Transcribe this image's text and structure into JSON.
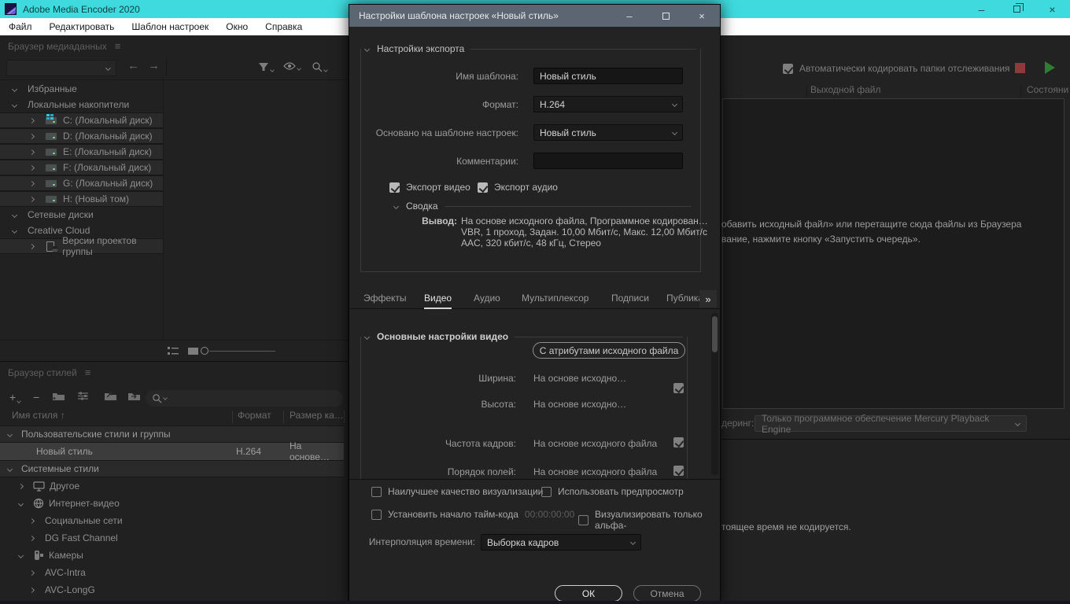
{
  "window": {
    "title": "Adobe Media Encoder 2020"
  },
  "glyphs": {
    "hamburger": "≡",
    "back": "←",
    "forward": "→",
    "sort_asc": "↑",
    "tab_overflow": "»",
    "minimize": "–",
    "close": "×",
    "plus": "+",
    "minus": "−"
  },
  "menu": {
    "items": [
      "Файл",
      "Редактировать",
      "Шаблон настроек",
      "Окно",
      "Справка"
    ]
  },
  "media_browser": {
    "title": "Браузер медиаданных",
    "tree": [
      {
        "label": "Избранные"
      },
      {
        "label": "Локальные накопители"
      },
      {
        "label": "C: (Локальный диск)"
      },
      {
        "label": "D: (Локальный диск)"
      },
      {
        "label": "E: (Локальный диск)"
      },
      {
        "label": "F: (Локальный диск)"
      },
      {
        "label": "G: (Локальный диск)"
      },
      {
        "label": "H: (Новый том)"
      },
      {
        "label": "Сетевые диски"
      },
      {
        "label": "Creative Cloud"
      },
      {
        "label": "Версии проектов группы"
      }
    ]
  },
  "preset_browser": {
    "title": "Браузер стилей",
    "columns": {
      "name": "Имя стиля",
      "format": "Формат",
      "size": "Размер ка…"
    },
    "rows": [
      {
        "label": "Пользовательские стили и группы"
      },
      {
        "label": "Новый стиль",
        "format": "H.264",
        "size": "На основе…"
      },
      {
        "label": "Системные стили"
      },
      {
        "label": "Другое"
      },
      {
        "label": "Интернет-видео"
      },
      {
        "label": "Социальные сети"
      },
      {
        "label": "DG Fast Channel"
      },
      {
        "label": "Камеры"
      },
      {
        "label": "AVC-Intra"
      },
      {
        "label": "AVC-LongG"
      }
    ]
  },
  "queue": {
    "auto_encode_label": "Автоматически кодировать папки отслеживания",
    "auto_encode_checked": true,
    "columns": {
      "output": "Выходной файл",
      "status": "Состояни"
    },
    "hint_line1": "обавить исходный файл» или перетащите сюда файлы из Браузера",
    "hint_line2": "вание, нажмите кнопку «Запустить очередь».",
    "renderer_label": "деринг:",
    "renderer_value": "Только программное обеспечение Mercury Playback Engine",
    "status_text": "тоящее время не кодируется."
  },
  "dialog": {
    "title": "Настройки шаблона настроек «Новый стиль»",
    "export_section": {
      "title": "Настройки экспорта",
      "name_label": "Имя шаблона:",
      "name_value": "Новый стиль",
      "format_label": "Формат:",
      "format_value": "H.264",
      "based_label": "Основано на шаблоне настроек:",
      "based_value": "Новый стиль",
      "comments_label": "Комментарии:",
      "comments_value": "",
      "export_video_label": "Экспорт видео",
      "export_video_checked": true,
      "export_audio_label": "Экспорт аудио",
      "export_audio_checked": true
    },
    "summary": {
      "title": "Сводка",
      "label": "Вывод:",
      "lines": [
        "На основе исходного файла, Программное кодирован…",
        "VBR, 1 проход, Задан. 10,00 Мбит/с, Макс. 12,00 Мбит/с",
        "AAC, 320 кбит/с, 48 кГц, Стерео"
      ]
    },
    "tabs": [
      "Эффекты",
      "Видео",
      "Аудио",
      "Мультиплексор",
      "Подписи",
      "Публикац"
    ],
    "active_tab": "Видео",
    "video_section": {
      "title": "Основные настройки видео",
      "match_source_button": "С атрибутами исходного файла",
      "width_label": "Ширина:",
      "width_value": "На основе исходно…",
      "height_label": "Высота:",
      "height_value": "На основе исходно…",
      "framerate_label": "Частота кадров:",
      "framerate_value": "На основе исходного файла",
      "fieldorder_label": "Порядок полей:",
      "fieldorder_value": "На основе исходного файла"
    },
    "bottom": {
      "best_quality_label": "Наилучшее качество визуализации",
      "use_preview_label": "Использовать предпросмотр",
      "set_timecode_label": "Установить начало тайм-кода",
      "timecode_value": "00:00:00:00",
      "alpha_only_label": "Визуализировать только альфа-",
      "interp_label": "Интерполяция времени:",
      "interp_value": "Выборка кадров",
      "ok_label": "ОК",
      "cancel_label": "Отмена"
    }
  }
}
